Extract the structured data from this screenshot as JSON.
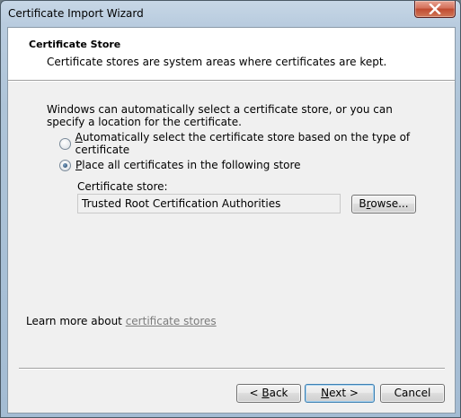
{
  "window": {
    "title": "Certificate Import Wizard"
  },
  "header": {
    "title": "Certificate Store",
    "subtitle": "Certificate stores are system areas where certificates are kept."
  },
  "body": {
    "description": "Windows can automatically select a certificate store, or you can specify a location for the certificate.",
    "options": [
      {
        "label_prefix": "",
        "accel": "A",
        "label_rest": "utomatically select the certificate store based on the type of certificate",
        "selected": false
      },
      {
        "label_prefix": "",
        "accel": "P",
        "label_rest": "lace all certificates in the following store",
        "selected": true
      }
    ],
    "store_label": "Certificate store:",
    "store_value": "Trusted Root Certification Authorities",
    "browse": {
      "accel": "r",
      "prefix": "B",
      "rest": "owse..."
    }
  },
  "footer": {
    "learn_prefix": "Learn more about ",
    "learn_link": "certificate stores",
    "back": {
      "prefix": "< ",
      "accel": "B",
      "rest": "ack"
    },
    "next": {
      "accel": "N",
      "rest": "ext >"
    },
    "cancel": "Cancel"
  },
  "colors": {
    "accent_border": "#3c7fb1",
    "link": "#7b7b7b"
  },
  "icons": {
    "close": "close-icon"
  }
}
